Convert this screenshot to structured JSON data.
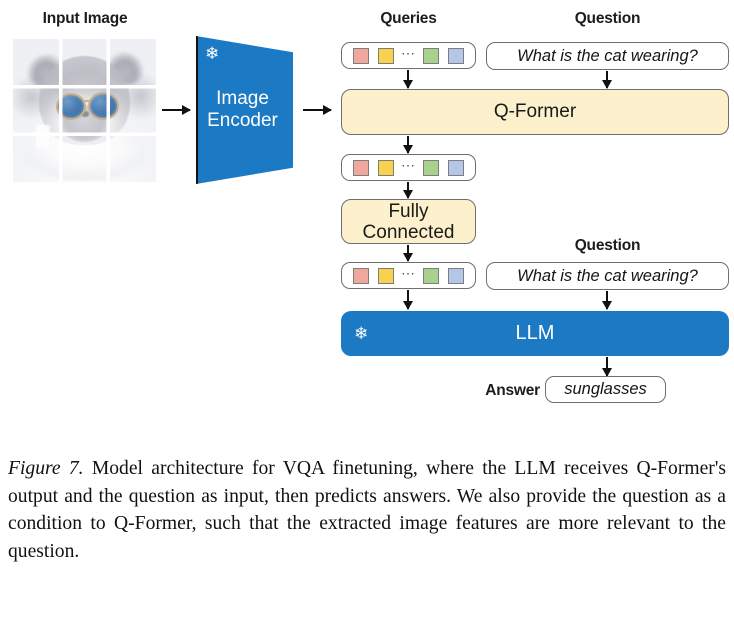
{
  "figure": {
    "caption_prefix": "Figure 7.",
    "caption_body": " Model architecture for VQA finetuning, where the LLM receives Q-Former's output and the question as input, then predicts answers. We also provide the question as a condition to Q-Former, such that the extracted image features are more relevant to the question."
  },
  "labels": {
    "input_image": "Input Image",
    "queries": "Queries",
    "question_top": "Question",
    "question_bottom": "Question",
    "answer": "Answer"
  },
  "blocks": {
    "image_encoder": "Image\nEncoder",
    "image_encoder_line1": "Image",
    "image_encoder_line2": "Encoder",
    "q_former": "Q-Former",
    "fully_connected_line1": "Fully",
    "fully_connected_line2": "Connected",
    "llm": "LLM"
  },
  "text_values": {
    "question_top": "What is the cat wearing?",
    "question_bottom": "What is the cat wearing?",
    "answer": "sunglasses"
  },
  "icons": {
    "snowflake": "❄",
    "ellipsis": "⋯"
  },
  "colors": {
    "accent_blue": "#1c7ac4",
    "block_cream": "#fdf0cd",
    "token_red": "#f1a79c",
    "token_yellow": "#f8d14f",
    "token_green": "#a9d18e",
    "token_blue": "#b4c7e7",
    "box_border": "#6e6e6e",
    "arrow": "#111111",
    "background": "#ffffff"
  },
  "tokens": [
    {
      "name": "token-red",
      "color": "#f1a79c"
    },
    {
      "name": "token-yellow",
      "color": "#f8d14f"
    },
    {
      "name": "token-green",
      "color": "#a9d18e"
    },
    {
      "name": "token-blue",
      "color": "#b4c7e7"
    }
  ]
}
